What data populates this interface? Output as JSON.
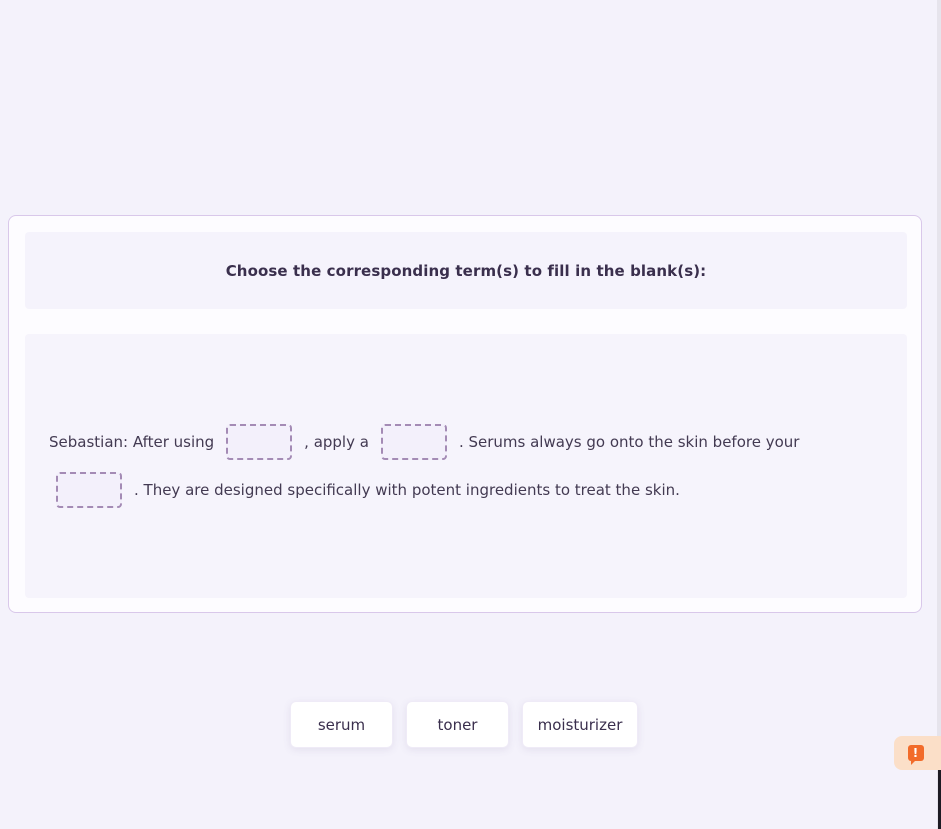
{
  "instruction": "Choose the corresponding term(s) to fill in the blank(s):",
  "sentence": {
    "part1": "Sebastian: After using",
    "part2": ", apply a",
    "part3": ". Serums always go onto the skin before your",
    "part4": ". They are designed specifically with potent ingredients to treat the skin."
  },
  "word_bank": [
    "serum",
    "toner",
    "moisturizer"
  ],
  "report": {
    "icon": "report-flag-icon",
    "symbol": "!",
    "color": "#f26b2a"
  }
}
